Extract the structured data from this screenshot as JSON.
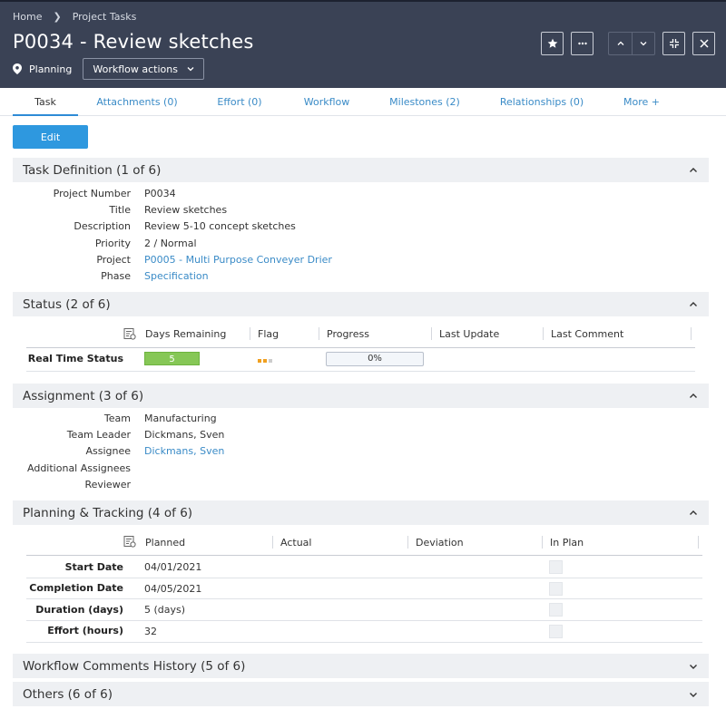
{
  "breadcrumb": {
    "home": "Home",
    "current": "Project Tasks"
  },
  "title": "P0034 - Review sketches",
  "phase": "Planning",
  "workflow_actions": "Workflow actions",
  "header_icons": [
    "star-icon",
    "more-icon",
    "chevron-up-icon",
    "chevron-down-icon",
    "collapse-icon",
    "close-icon"
  ],
  "tabs": [
    {
      "label": "Task"
    },
    {
      "label": "Attachments (0)"
    },
    {
      "label": "Effort (0)"
    },
    {
      "label": "Workflow"
    },
    {
      "label": "Milestones (2)"
    },
    {
      "label": "Relationships (0)"
    },
    {
      "label": "More +"
    }
  ],
  "edit_label": "Edit",
  "sections": {
    "definition": {
      "title": "Task Definition (1 of 6)",
      "fields": [
        {
          "label": "Project Number",
          "value": "P0034"
        },
        {
          "label": "Title",
          "value": "Review sketches"
        },
        {
          "label": "Description",
          "value": "Review 5-10 concept sketches"
        },
        {
          "label": "Priority",
          "value": "2 / Normal"
        },
        {
          "label": "Project",
          "value": "P0005 - Multi Purpose Conveyer Drier"
        },
        {
          "label": "Phase",
          "value": "Specification"
        }
      ]
    },
    "status": {
      "title": "Status (2 of 6)",
      "columns": [
        "Days Remaining",
        "Flag",
        "Progress",
        "Last Update",
        "Last Comment"
      ],
      "row_label": "Real Time Status",
      "days_remaining": "5",
      "progress": "0%",
      "progress_fraction": 0,
      "flag_colors": [
        "#f0a020",
        "#f0a020",
        "#cccccc"
      ]
    },
    "assignment": {
      "title": "Assignment (3 of 6)",
      "fields": [
        {
          "label": "Team",
          "value": "Manufacturing"
        },
        {
          "label": "Team Leader",
          "value": "Dickmans, Sven"
        },
        {
          "label": "Assignee",
          "value": "Dickmans, Sven"
        },
        {
          "label": "Additional Assignees",
          "value": ""
        },
        {
          "label": "Reviewer",
          "value": ""
        }
      ]
    },
    "planning": {
      "title": "Planning & Tracking (4 of 6)",
      "columns": [
        "Planned",
        "Actual",
        "Deviation",
        "In Plan"
      ],
      "rows": [
        {
          "label": "Start Date",
          "planned": "04/01/2021"
        },
        {
          "label": "Completion Date",
          "planned": "04/05/2021"
        },
        {
          "label": "Duration (days)",
          "planned": "5 (days)"
        },
        {
          "label": "Effort (hours)",
          "planned": "32"
        }
      ]
    },
    "comments": {
      "title": "Workflow Comments History (5 of 6)"
    },
    "others": {
      "title": "Others (6 of 6)"
    }
  },
  "colors": {
    "header_bg": "#3a4255",
    "accent": "#2e98df",
    "link": "#3a8bc7",
    "days_bar": "#86c756"
  }
}
